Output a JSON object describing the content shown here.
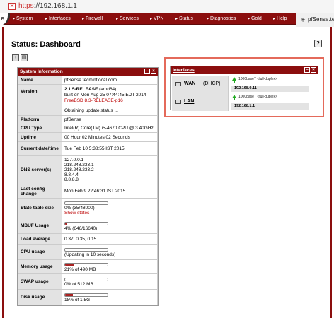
{
  "browser": {
    "url_scheme": "https",
    "url_rest": "://192.168.1.1"
  },
  "nav": {
    "items": [
      "System",
      "Interfaces",
      "Firewall",
      "Services",
      "VPN",
      "Status",
      "Diagnostics",
      "Gold",
      "Help"
    ],
    "brand": "pfSense.te"
  },
  "page": {
    "title": "Status: Dashboard",
    "help": "?"
  },
  "system_info": {
    "title": "System Information",
    "rows": {
      "name_label": "Name",
      "name": "pfSense.tecmintlocal.com",
      "version_label": "Version",
      "version_release": "2.1.5-RELEASE",
      "version_arch": " (amd64)",
      "version_built": "built on Mon Aug 25 07:44:45 EDT 2014",
      "version_freebsd": "FreeBSD 8.3-RELEASE-p16",
      "version_update": "Obtaining update status ...",
      "platform_label": "Platform",
      "platform": "pfSense",
      "cpu_type_label": "CPU Type",
      "cpu_type": "Intel(R) Core(TM) i5-4670 CPU @ 3.40GHz",
      "uptime_label": "Uptime",
      "uptime": "00 Hour 02 Minutes 02 Seconds",
      "current_dt_label": "Current date/time",
      "current_dt": "Tue Feb 10 5:38:55 IST 2015",
      "dns_label": "DNS server(s)",
      "dns": [
        "127.0.0.1",
        "218.248.233.1",
        "218.248.233.2",
        "8.8.4.4",
        "8.8.8.8"
      ],
      "last_config_label": "Last config change",
      "last_config": "Mon Feb 9 22:46:31 IST 2015",
      "state_table_label": "State table size",
      "state_table": "0% (35/48000)",
      "state_table_fraction": 0.0,
      "show_states": "Show states",
      "mbuf_label": "MBUF Usage",
      "mbuf": "4% (646/16640)",
      "mbuf_fraction": 0.04,
      "load_label": "Load average",
      "load": "0.37, 0.35, 0.15",
      "cpu_label": "CPU usage",
      "cpu": "(Updating in 10 seconds)",
      "cpu_fraction": 0.0,
      "memory_label": "Memory usage",
      "memory": "21% of 490 MB",
      "memory_fraction": 0.21,
      "swap_label": "SWAP usage",
      "swap": "0% of 512 MB",
      "swap_fraction": 0.0,
      "disk_label": "Disk usage",
      "disk": "18% of 1.5G",
      "disk_fraction": 0.18
    }
  },
  "interfaces": {
    "title": "Interfaces",
    "list": [
      {
        "name": "WAN",
        "type": "(DHCP)",
        "media": "1000baseT <full-duplex>",
        "ip": "192.168.0.11"
      },
      {
        "name": "LAN",
        "type": "",
        "media": "1000baseT <full-duplex>",
        "ip": "192.168.1.1"
      }
    ]
  },
  "colors": {
    "nav_bg": "#8b0e0e",
    "highlight": "#e46a5b",
    "bar_fill": "#a22"
  }
}
